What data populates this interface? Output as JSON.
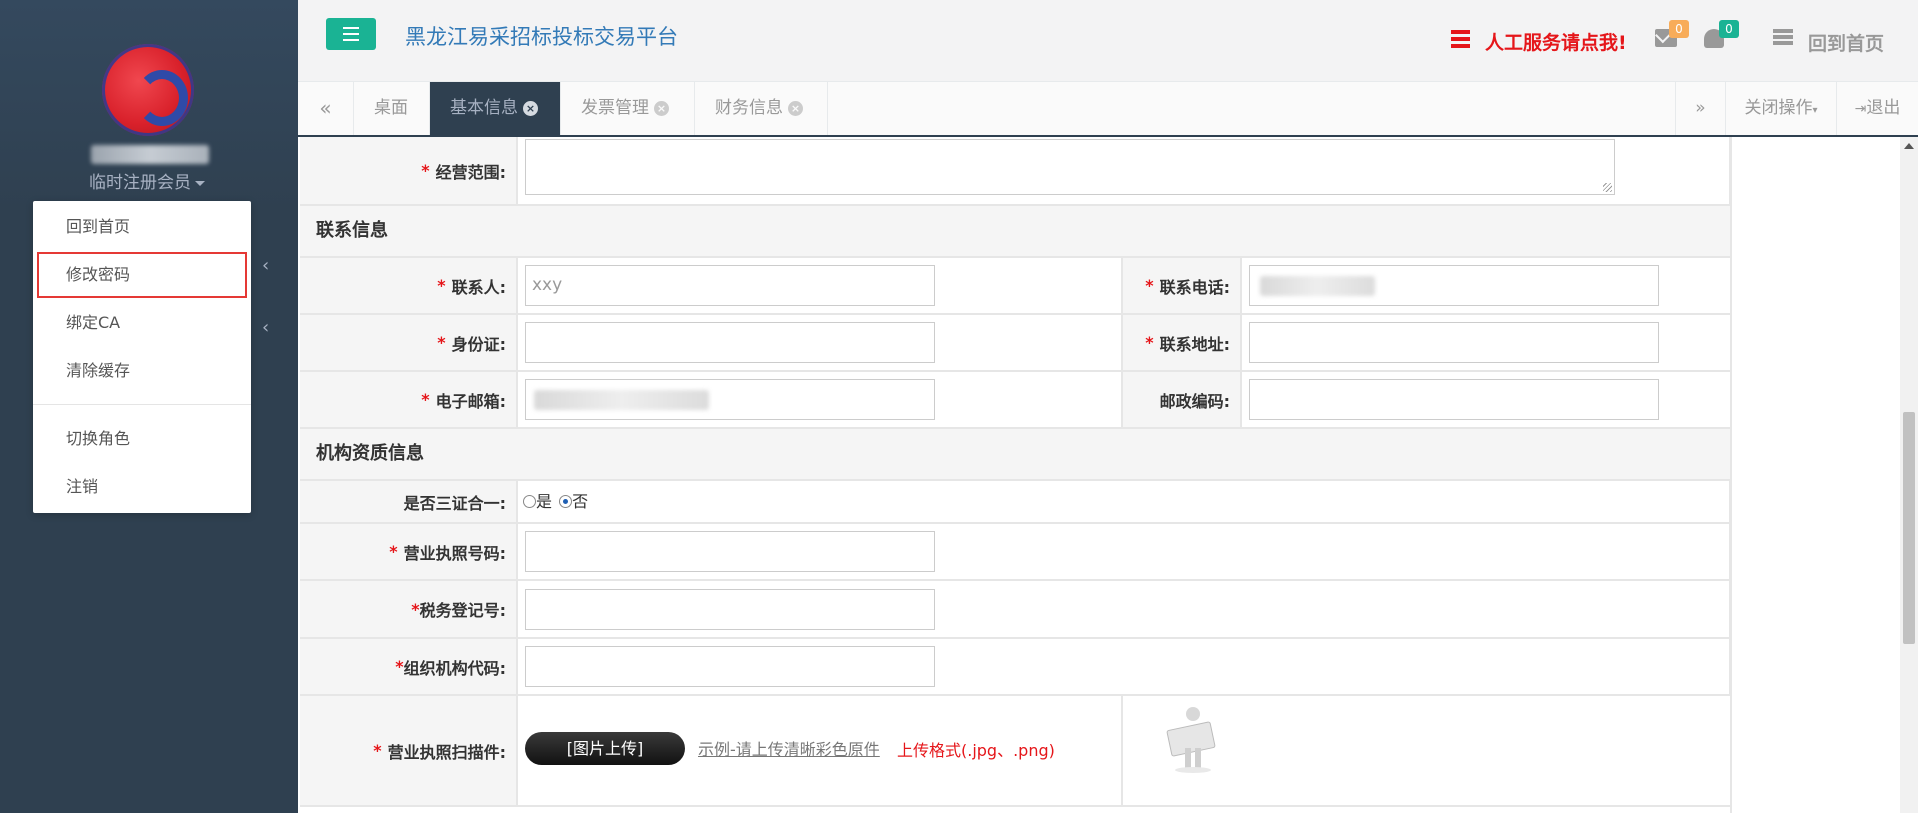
{
  "sidebar": {
    "role_label": "临时注册会员",
    "menu": [
      {
        "label": "回到首页"
      },
      {
        "label": "修改密码"
      },
      {
        "label": "绑定CA"
      },
      {
        "label": "清除缓存"
      },
      {
        "label": "切换角色"
      },
      {
        "label": "注销"
      }
    ]
  },
  "header": {
    "title": "黑龙江易采招标投标交易平台",
    "service_link": "人工服务请点我!",
    "messages_count": "0",
    "notifications_count": "0",
    "home_label": "回到首页"
  },
  "tabs": {
    "items": [
      {
        "label": "桌面"
      },
      {
        "label": "基本信息"
      },
      {
        "label": "发票管理"
      },
      {
        "label": "财务信息"
      }
    ],
    "close_ops_label": "关闭操作",
    "logout_label": "退出"
  },
  "form": {
    "business_scope_label": "经营范围:",
    "contact_section": "联系信息",
    "contact_person_label": "联系人:",
    "contact_person_value": "xxy",
    "contact_phone_label": "联系电话:",
    "id_card_label": "身份证:",
    "address_label": "联系地址:",
    "email_label": "电子邮箱:",
    "postcode_label": "邮政编码:",
    "qualification_section": "机构资质信息",
    "three_in_one_label": "是否三证合一:",
    "yes_label": "是",
    "no_label": "否",
    "three_in_one_selected": "否",
    "license_no_label": "营业执照号码:",
    "tax_no_label": "税务登记号:",
    "org_code_label": "组织机构代码:",
    "license_scan_label": "营业执照扫描件:",
    "upload_button": "[图片上传]",
    "sample_link": "示例-请上传清晰彩色原件",
    "format_note": "上传格式(.jpg、.png)"
  },
  "colors": {
    "sidebar_bg": "#2f4050",
    "accent_green": "#1ab394",
    "required_red": "#e5161a",
    "title_blue": "#337ab7"
  }
}
